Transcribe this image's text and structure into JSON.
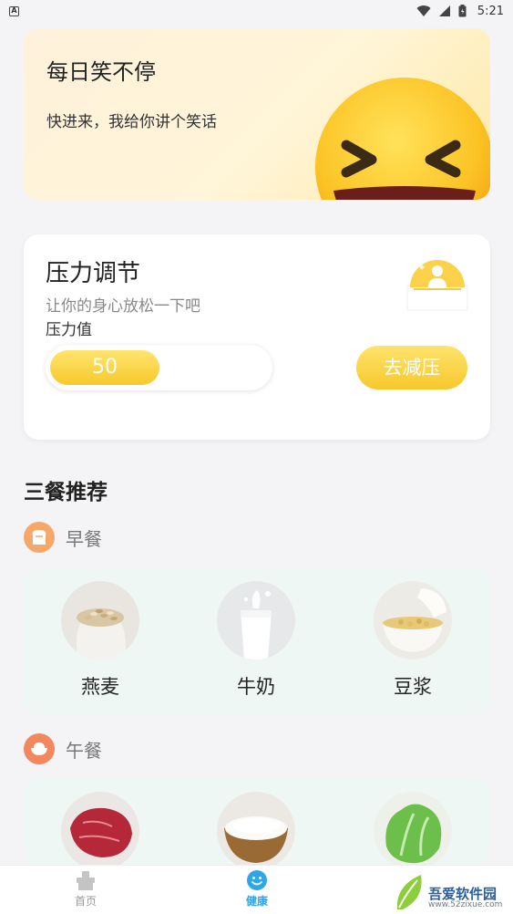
{
  "status_bar": {
    "time": "5:21",
    "left_badge": "A"
  },
  "joke_banner": {
    "title": "每日笑不停",
    "subtitle": "快进来，我给你讲个笑话",
    "icon": "laughing-emoji-icon"
  },
  "stress": {
    "title": "压力调节",
    "subtitle": "让你的身心放松一下吧",
    "value_label": "压力值",
    "value": "50",
    "value_fraction": 0.5,
    "button_label": "去减压"
  },
  "meals": {
    "section_title": "三餐推荐",
    "breakfast": {
      "label": "早餐",
      "icon": "bread-icon",
      "items": [
        {
          "name": "燕麦",
          "image": "oats"
        },
        {
          "name": "牛奶",
          "image": "milk"
        },
        {
          "name": "豆浆",
          "image": "soy-milk"
        }
      ]
    },
    "lunch": {
      "label": "午餐",
      "icon": "rice-bowl-icon",
      "items": [
        {
          "image": "beef"
        },
        {
          "image": "rice"
        },
        {
          "image": "lettuce"
        }
      ]
    }
  },
  "bottom_nav": {
    "items": [
      {
        "label": "首页",
        "icon": "home-icon",
        "active": false
      },
      {
        "label": "健康",
        "icon": "smile-icon",
        "active": true
      }
    ]
  },
  "watermark": {
    "title": "吾爱软件园",
    "url": "www.52zixue.com"
  },
  "colors": {
    "accent_yellow": "#f7c92c",
    "active_blue": "#2ea6e8",
    "meal_icon_orange": "#f5a86a"
  }
}
